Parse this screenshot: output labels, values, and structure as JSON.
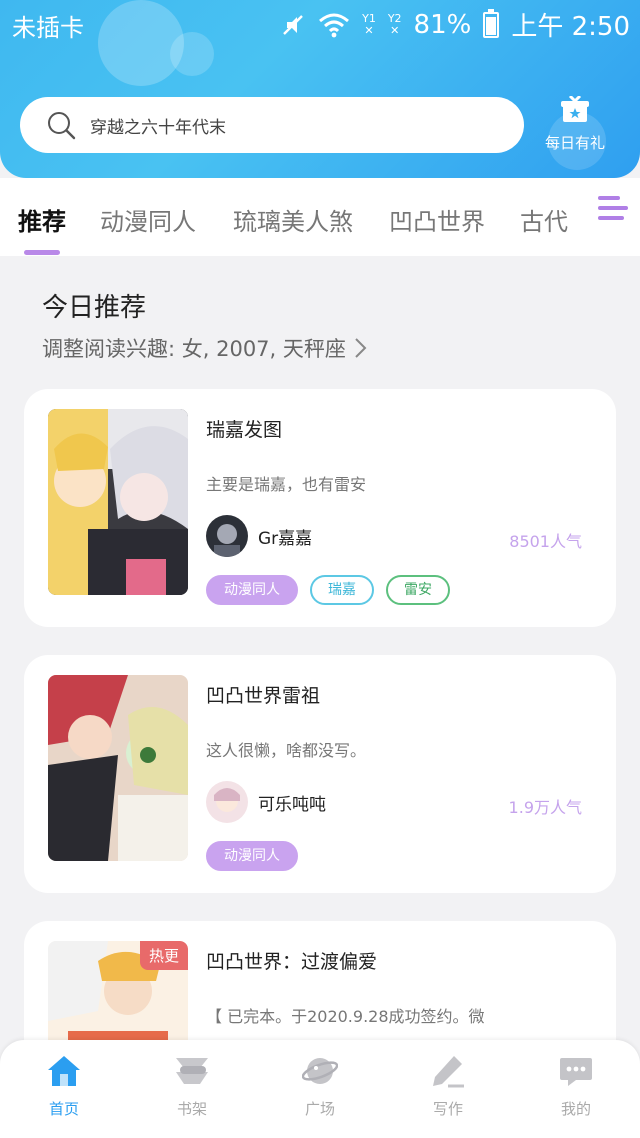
{
  "status_bar": {
    "carrier": "未插卡",
    "sim1": "Y1",
    "sim2": "Y2",
    "battery": "81%",
    "time": "上午 2:50"
  },
  "search": {
    "placeholder": "穿越之六十年代末"
  },
  "gift": {
    "label": "每日有礼"
  },
  "tabs": [
    {
      "label": "推荐",
      "active": true
    },
    {
      "label": "动漫同人"
    },
    {
      "label": "琉璃美人煞"
    },
    {
      "label": "凹凸世界"
    },
    {
      "label": "古代"
    }
  ],
  "section": {
    "title": "今日推荐",
    "interest": "调整阅读兴趣: 女, 2007, 天秤座"
  },
  "cards": [
    {
      "title": "瑞嘉发图",
      "desc": "主要是瑞嘉，也有雷安",
      "author": "Gr嘉嘉",
      "popularity": "8501人气",
      "tags": [
        "动漫同人",
        "瑞嘉",
        "雷安"
      ]
    },
    {
      "title": "凹凸世界雷祖",
      "desc": "这人很懒，啥都没写。",
      "author": "可乐吨吨",
      "popularity": "1.9万人气",
      "tags": [
        "动漫同人"
      ]
    },
    {
      "title": "凹凸世界：过渡偏爱",
      "desc": "【 已完本。于2020.9.28成功签约。微",
      "badge": "热更"
    }
  ],
  "bottom_nav": [
    {
      "label": "首页",
      "icon": "home-icon",
      "active": true
    },
    {
      "label": "书架",
      "icon": "bookshelf-icon"
    },
    {
      "label": "广场",
      "icon": "planet-icon"
    },
    {
      "label": "写作",
      "icon": "pen-icon"
    },
    {
      "label": "我的",
      "icon": "chat-icon"
    }
  ],
  "colors": {
    "header": "#3fb8f0",
    "accent": "#b989e8",
    "active_nav": "#2b9ef0",
    "tag_purple": "#c9a3ef",
    "tag_cyan": "#5cc8e4",
    "tag_green": "#5cc07e",
    "hot": "#e86a6a"
  }
}
